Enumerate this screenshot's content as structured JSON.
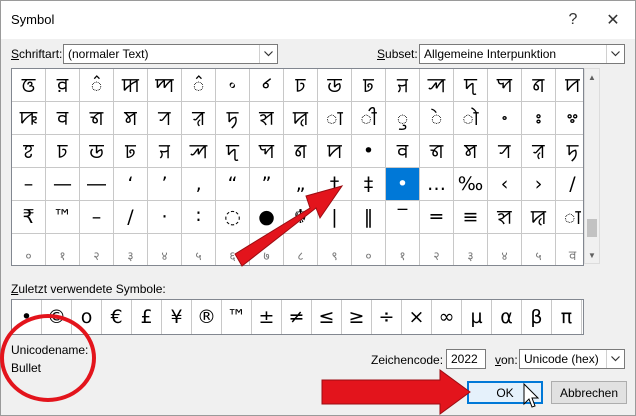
{
  "window": {
    "title": "Symbol",
    "help_glyph": "?",
    "close_glyph": "✕"
  },
  "font": {
    "label_prefix": "",
    "label_accel": "S",
    "label_rest": "chriftart:",
    "value": "(normaler Text)"
  },
  "subset": {
    "label_accel": "S",
    "label_rest": "ubset:",
    "value": "Allgemeine Interpunktion"
  },
  "grid": {
    "rows": [
      [
        "ꠃ",
        "ꠅ",
        "꠆",
        "ꠇ",
        "ꠈ",
        "꠆",
        "꠶",
        "꠷",
        "ꠑ",
        "ꠒ",
        "ꠓ",
        "ꠔ",
        "ꠕ",
        "ꠖ",
        "ꠗ",
        "ꠘ",
        "ꠙ"
      ],
      [
        "ꠚ",
        "ꠛ",
        "ꠜ",
        "ꠝ",
        "ꠞ",
        "ꠟ",
        "ꠠ",
        "ꠡ",
        "ꠢ",
        "ꠣ",
        "ꠤ",
        "ꠥ",
        "ꠦ",
        "ꠧ",
        "꠨",
        "꠩",
        "꠪"
      ],
      [
        "ꠐ",
        "ꠑ",
        "ꠒ",
        "ꠓ",
        "ꠔ",
        "ꠕ",
        "ꠖ",
        "ꠗ",
        "ꠘ",
        "ꠙ",
        "•",
        "ꠛ",
        "ꠜ",
        "ꠝ",
        "ꠞ",
        "ꠟ",
        "ꠠ"
      ],
      [
        "–",
        "—",
        "―",
        "‘",
        "’",
        "‚",
        "“",
        "”",
        "„",
        "†",
        "‡",
        "•",
        "…",
        "‰",
        "‹",
        "›",
        "/",
        "₨",
        "€"
      ],
      [
        "₹",
        "™",
        "–",
        "/",
        "·",
        "∶",
        "◌",
        "●",
        "☬",
        "|",
        "‖",
        "‾",
        "═",
        "≡",
        "ꠡ",
        "ꠢ",
        "ꠣ"
      ],
      [
        "०",
        "१",
        "२",
        "३",
        "४",
        "५",
        "६",
        "७",
        "८",
        "९",
        "०",
        "१",
        "२",
        "३",
        "४",
        "५",
        "ꠛ"
      ]
    ],
    "selected": "•"
  },
  "recent": {
    "label_accel": "Z",
    "label_rest": "uletzt verwendete Symbole:",
    "symbols": [
      "•",
      "©",
      "o",
      "€",
      "£",
      "¥",
      "®",
      "™",
      "±",
      "≠",
      "≤",
      "≥",
      "÷",
      "×",
      "∞",
      "µ",
      "α",
      "β",
      "π"
    ]
  },
  "info": {
    "unicodename_label": "Unicodename:",
    "unicodename_value": "Bullet",
    "zeichencode_label": "Zeichencode:",
    "zeichencode_accel": "c",
    "zeichencode_value": "2022",
    "von_label_accel": "v",
    "von_label_rest": "on:",
    "von_value": "Unicode (hex)"
  },
  "buttons": {
    "ok": "OK",
    "cancel": "Abbrechen"
  },
  "colors": {
    "selection": "#0078d7",
    "annotation": "#e3141c"
  }
}
